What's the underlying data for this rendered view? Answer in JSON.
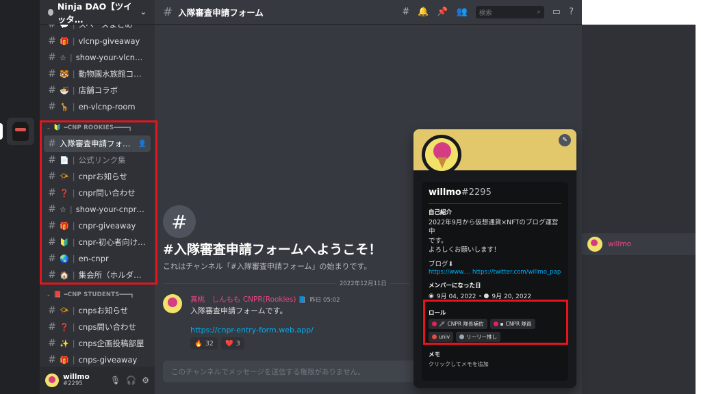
{
  "guild": {
    "name": "Ninja DAO【ツイッタ…"
  },
  "channels_top": [
    {
      "emoji": "💬",
      "name": "スペースまとめ"
    },
    {
      "emoji": "🎁",
      "name": "vlcnp-giveaway"
    },
    {
      "emoji": "☆",
      "name": "show-your-vlcnp…"
    },
    {
      "emoji": "🐯",
      "name": "動物園水族館コ…"
    },
    {
      "emoji": "🍜",
      "name": "店舗コラボ"
    },
    {
      "emoji": "🦒",
      "name": "en-vlcnp-room"
    }
  ],
  "category_rookies": {
    "emoji": "🔰",
    "label": "━CNP ROOKIES━━━━┓"
  },
  "channels_rookies": [
    {
      "emoji": "",
      "name": "入隊審査申請フォーム",
      "active": true
    },
    {
      "emoji": "📄",
      "name": "公式リンク集",
      "muted": true
    },
    {
      "emoji": "📯",
      "name": "cnprお知らせ"
    },
    {
      "emoji": "❓",
      "name": "cnpr問い合わせ"
    },
    {
      "emoji": "☆",
      "name": "show-your-cnpr（…"
    },
    {
      "emoji": "🎁",
      "name": "cnpr-giveaway"
    },
    {
      "emoji": "🔰",
      "name": "cnpr-初心者向け…"
    },
    {
      "emoji": "🌏",
      "name": "en-cnpr"
    },
    {
      "emoji": "🏠",
      "name": "集会所（ホルダ…"
    }
  ],
  "category_students": {
    "emoji": "📕",
    "label": "━CNP STUDENTS━━━┓"
  },
  "channels_students": [
    {
      "emoji": "📯",
      "name": "cnpsお知らせ"
    },
    {
      "emoji": "❓",
      "name": "cnps問い合わせ"
    },
    {
      "emoji": "✨",
      "name": "cnps企画投稿部屋"
    },
    {
      "emoji": "🎁",
      "name": "cnps-giveaway"
    }
  ],
  "user": {
    "name": "willmo",
    "tag": "#2295"
  },
  "header": {
    "channel": "入隊審査申請フォーム",
    "search_placeholder": "検索"
  },
  "welcome": {
    "hash": "#",
    "title": "#入隊審査申請フォームへようこそ！",
    "subtitle": "これはチャンネル「#入隊審査申請フォーム」の始まりです。",
    "date": "2022年12月11日"
  },
  "message": {
    "author": "真桃　しんもも CNPR(Rookies)",
    "time": "昨日 05:02",
    "text": "入隊審査申請フォームです。",
    "link": "https://cnpr-entry-form.web.app/",
    "reactions": [
      {
        "emoji": "🔥",
        "count": "32"
      },
      {
        "emoji": "❤️",
        "count": "3"
      }
    ]
  },
  "composer_placeholder": "このチャンネルでメッセージを送信する権限がありません。",
  "member": {
    "name": "willmo"
  },
  "profile": {
    "name": "willmo",
    "discriminator": "#2295",
    "bio_title": "自己紹介",
    "bio_lines": [
      "2022年9月から仮想通貨×NFTのブログ運営中",
      "です。",
      "よろしくお願いします！"
    ],
    "blog_label": "ブログ⬇",
    "links": "https://www.... https://twitter.com/willmo_papa",
    "member_since_title": "メンバーになった日",
    "discord_since": "9月 04, 2022",
    "server_since": "9月 20, 2022",
    "roles_title": "ロール",
    "roles": [
      {
        "label": "CNPR 隊長補佐",
        "color": "#e91e63"
      },
      {
        "label": "CNPR 隊員",
        "color": "#e91e63"
      },
      {
        "label": "univ",
        "color": "#e74c3c"
      },
      {
        "label": "リーリー推し",
        "color": "#99aab5"
      }
    ],
    "note_title": "メモ",
    "note_placeholder": "クリックしてメモを追加"
  },
  "colors": {
    "highlight": "#e5151d",
    "banner": "#e2c86b",
    "role_author": "#f04784"
  }
}
